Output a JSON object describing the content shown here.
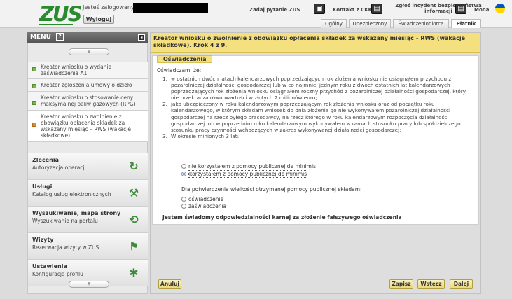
{
  "header": {
    "logo": "ZUS",
    "login_text": "Jesteś zalogowany jako:",
    "logout": "Wyloguj",
    "ask": "Zadaj pytanie ZUS",
    "contact": "Kontakt z CKK",
    "incident": "Zgłoś incydent bezpieczeństwa informacji",
    "user": "Mona",
    "tabs": [
      "Ogólny",
      "Ubezpieczony",
      "Świadczeniobiorca",
      "Płatnik"
    ]
  },
  "menu": {
    "title": "MENU",
    "help": "?",
    "collapse": "◂",
    "scroll_up": "▲",
    "scroll_down": "▼",
    "items": [
      "Kreator wniosku o wydanie zaświadczenia A1",
      "Kreator zgłoszenia umowy o dzieło",
      "Kreator wniosku o stosowanie ceny maksymalnej paliw gazowych (RPG)",
      "Kreator wniosku o zwolnienie z obowiązku opłacenia składek za wskazany miesiąc – RWS (wakacje składkowe)"
    ],
    "sections": [
      {
        "title": "Zlecenia",
        "sub": "Autoryzacja operacji",
        "icon": "refresh-icon"
      },
      {
        "title": "Usługi",
        "sub": "Katalog usług elektronicznych",
        "icon": "tools-icon"
      },
      {
        "title": "Wyszukiwanie, mapa strony",
        "sub": "Wyszukiwanie na portalu",
        "icon": "search-sync-icon"
      },
      {
        "title": "Wizyty",
        "sub": "Rezerwacja wizyty w ZUS",
        "icon": "walking-person-icon"
      },
      {
        "title": "Ustawienia",
        "sub": "Konfiguracja profilu",
        "icon": "gear-icon"
      }
    ]
  },
  "main": {
    "title": "Kreator wniosku o zwolnienie z obowiązku opłacenia składek za wskazany miesiąc – RWS (wakacje składkowe). Krok 4 z 9.",
    "badge": "Oświadczenia",
    "oswiadczam": "Oświadczam, że:",
    "points": [
      {
        "n": "1.",
        "t": "w ostatnich dwóch latach kalendarzowych poprzedzających rok złożenia wniosku nie osiągnąłem przychodu z pozarolniczej działalności gospodarczej lub w co najmniej jednym roku z dwóch ostatnich lat kalendarzowych poprzedzających rok złożenia wniosku osiągnąłem roczny przychód z pozarolniczej działalności gospodarczej, który nie przekracza równowartości w złotych 2 milionów euro;"
      },
      {
        "n": "2.",
        "t": "jako ubezpieczony w roku kalendarzowym poprzedzającym rok złożenia wniosku oraz od początku roku kalendarzowego, w którym składam wniosek do dnia złożenia go nie wykonywałem pozarolniczej działalności gospodarczej na rzecz byłego pracodawcy, na rzecz którego w roku kalendarzowym rozpoczęcia działalności gospodarczej lub w poprzednim roku kalendarzowym wykonywałem w ramach stosunku pracy lub spółdzielczego stosunku pracy czynności wchodzących w zakres wykonywanej działalności gospodarczej;"
      },
      {
        "n": "3.",
        "t": "W okresie minionych 3 lat:"
      }
    ],
    "radio1": [
      "nie korzystałem z pomocy publicznej de minimis",
      "korzystałem z pomocy publicznej de minimis"
    ],
    "radio1_selected": 1,
    "dla": "Dla potwierdzenia wielkości otrzymanej pomocy publicznej składam:",
    "radio2": [
      "oświadczenie",
      "zaświadczenia"
    ],
    "bold": "Jestem świadomy odpowiedzialności karnej za złożenie fałszywego oświadczenia"
  },
  "buttons": {
    "cancel": "Anuluj",
    "save": "Zapisz",
    "back": "Wstecz",
    "next": "Dalej"
  }
}
